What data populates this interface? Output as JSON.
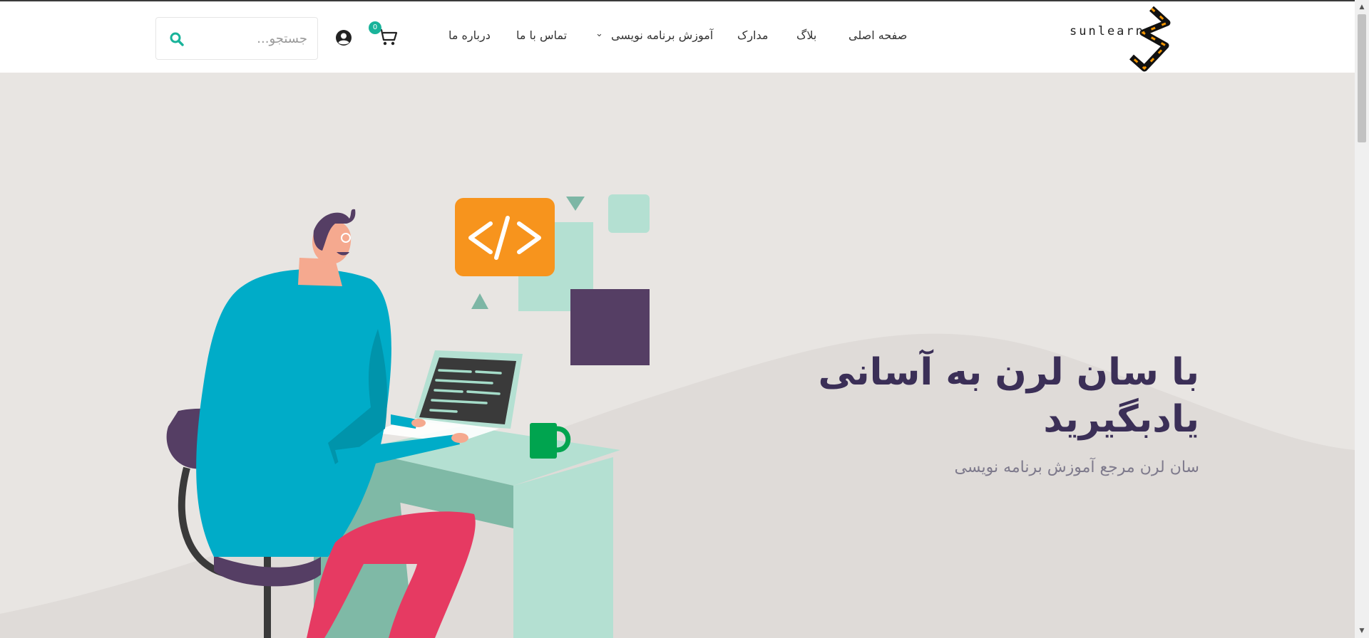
{
  "header": {
    "logo_text": "sunlearn",
    "nav": {
      "home": "صفحه اصلی",
      "blog": "بلاگ",
      "certificates": "مدارک",
      "programming": "آموزش برنامه نویسی",
      "contact": "تماس با ما",
      "about": "درباره ما"
    },
    "cart_count": "0",
    "search": {
      "placeholder": "جستجو..."
    }
  },
  "hero": {
    "title_line1": "با سان لرن به آسانی",
    "title_line2": "یادبگیرید",
    "subtitle": "سان لرن مرجع آموزش برنامه نویسی"
  },
  "colors": {
    "accent": "#19b39a",
    "title": "#3b2f57",
    "hero_bg": "#e8e5e2",
    "code_badge": "#f7941d"
  }
}
